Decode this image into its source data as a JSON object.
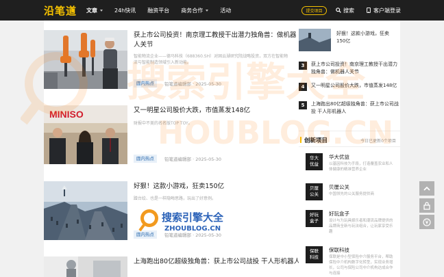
{
  "header": {
    "logo": "沿笔道",
    "nav": [
      "文章",
      "24h快讯",
      "融资平台",
      "商务合作",
      "活动"
    ],
    "submit": "提交项目",
    "search": "搜索",
    "client": "客户端",
    "login": "登录"
  },
  "articles": [
    {
      "title": "获上市公司投资！南京理工教授干出潜力独角兽：做机器人关节",
      "desc": "智能物流企业——德马科技（688360.SH）对固云湖研究院战略投资，双方在智能物流与智能制造领域引入新动能。",
      "tag": "圆内热点",
      "author": "铅笔道编辑部",
      "date": "· 2025-05-30"
    },
    {
      "title": "又一明星公司股价大跌，市值蒸发148亿",
      "desc": "财报中不美的名名版TOP TOY。",
      "tag": "圆内热点",
      "author": "铅笔道编辑部",
      "date": "· 2025-05-30",
      "image_text": "MINISO"
    },
    {
      "title": "好狠！这款小游戏，狂卖150亿",
      "desc": "蹭台绘、也是一样隐晦思路，玩出了好意例。",
      "tag": "圆内热点",
      "author": "铅笔道编辑部",
      "date": "· 2025-05-30"
    },
    {
      "title": "上海跑出80亿超级独角兽：获上市公司战投 干人形机器人",
      "desc": "",
      "tag": "",
      "author": "",
      "date": ""
    }
  ],
  "watermark": {
    "cn_top": "搜索引擎大全",
    "en_top": "HOUBLOG.CN",
    "cn_small": "搜索引擎大全",
    "en_small": "ZHOUBLOG.CN"
  },
  "sidebar": {
    "top_item": "好狠！这款小游戏，狂卖150亿",
    "ranked": [
      {
        "num": "3",
        "title": "获上市公司投资！南京理工教授干出潜力独角兽：做机器人关节"
      },
      {
        "num": "4",
        "title": "又一明星公司股价大跌，市值蒸发148亿"
      },
      {
        "num": "5",
        "title": "上海跑出80亿超级独角兽：获上市公司战投 干人形机器人"
      }
    ],
    "section_title": "创新项目",
    "section_update": "今日已更新0个项目",
    "projects": [
      {
        "badge1": "华大",
        "badge2": "优益",
        "name": "华大优益",
        "desc": "以基因科技为手段，打造覆盖农业和人体健康的精准营养企业"
      },
      {
        "badge1": "贝厘",
        "badge2": "公关",
        "name": "贝厘公关",
        "desc": "中国领先的公关服务提供商"
      },
      {
        "badge1": "好玩",
        "badge2": "盒子",
        "name": "好玩盒子",
        "desc": "设计与为玩具娱乐者和潮流品牌提供的品牌商全新与玩法组合，让玩家享受乐趣"
      },
      {
        "badge1": "保联",
        "badge2": "科技",
        "name": "保联科技",
        "desc": "保联是中小型保险中介服务平台，帮助保险中介机构数字化转型，实现业务增长，公司与保险公司中介机构达成合作与连接"
      }
    ]
  },
  "colors": {
    "accent": "#f6c200",
    "header_bg": "#1f1f1f",
    "tag_text": "#2b6bb0"
  }
}
